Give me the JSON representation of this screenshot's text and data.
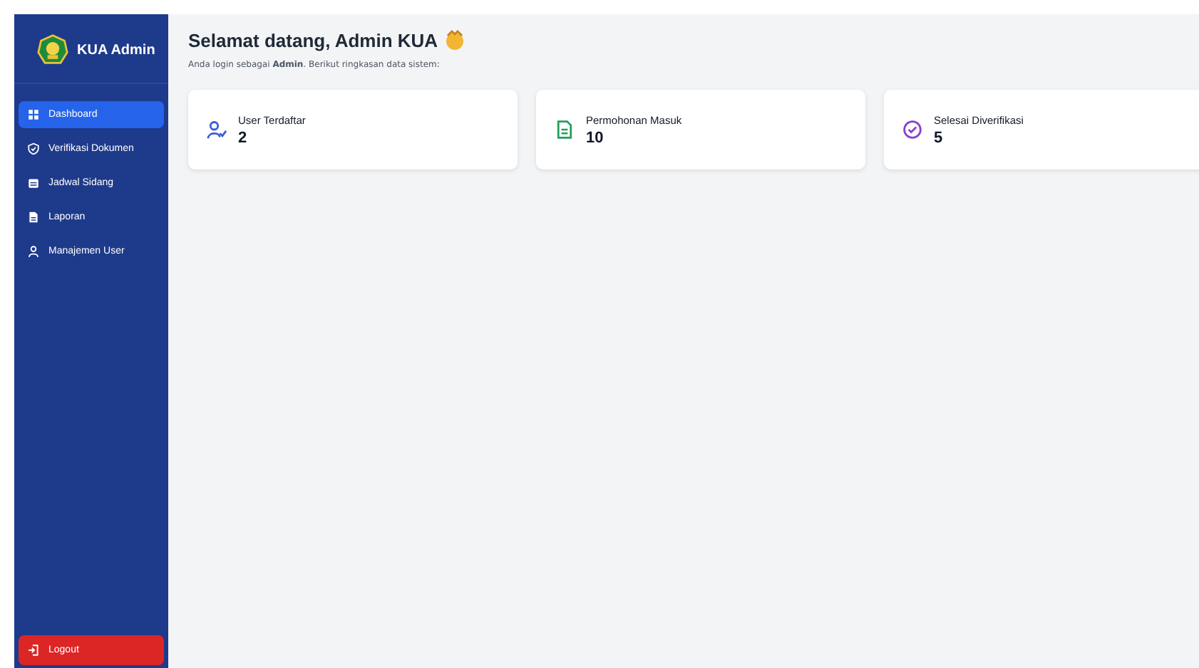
{
  "sidebar": {
    "brand": "KUA Admin",
    "items": [
      {
        "label": "Dashboard",
        "selected": true
      },
      {
        "label": "Verifikasi Dokumen",
        "selected": false
      },
      {
        "label": "Jadwal Sidang",
        "selected": false
      },
      {
        "label": "Laporan",
        "selected": false
      },
      {
        "label": "Manajemen User",
        "selected": false
      }
    ],
    "logout": "Logout"
  },
  "header": {
    "title": "Selamat datang, Admin KUA",
    "subtitle": "Anda login sebagai **Admin**. Berikut ringkasan data sistem:"
  },
  "cards": [
    {
      "label": "User Terdaftar",
      "value": "2",
      "color": "#3b5bdb"
    },
    {
      "label": "Permohonan Masuk",
      "value": "10",
      "color": "#22a05a"
    },
    {
      "label": "Selesai Diverifikasi",
      "value": "5",
      "color": "#8b3fd1"
    }
  ]
}
